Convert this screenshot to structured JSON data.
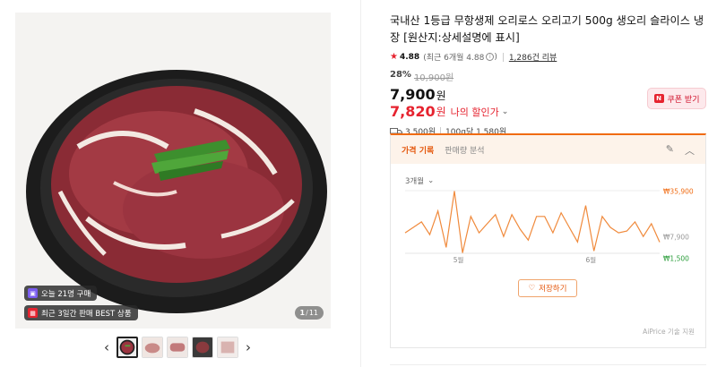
{
  "gallery": {
    "badge_buyers": "오늘 21명 구매",
    "badge_best": "최근 3일간 판매 BEST 상품",
    "counter_current": "1",
    "counter_total": "11",
    "thumb_count": 5
  },
  "product": {
    "title": "국내산 1등급 무항생제 오리로스 오리고기 500g 생오리 슬라이스 냉장 [원산지:상세설명에 표시]",
    "rating": "4.88",
    "rating_recent": "(최근 6개월 4.88",
    "rating_recent_close": ")",
    "review_count": "1,286건 리뷰",
    "discount_pct": "28%",
    "original_price": "10,900원",
    "price": "7,900",
    "price_unit": "원",
    "my_price": "7,820",
    "my_price_unit": "원",
    "my_price_label": "나의 할인가",
    "coupon_label": "쿠폰 받기",
    "coupon_icon_letter": "N",
    "shipping_fee": "3,500원",
    "unit_price": "100g당 1,580원"
  },
  "price_panel": {
    "tab_active": "가격 기록",
    "tab_other": "판매량 분석",
    "period": "3개월",
    "save_label": "저장하기",
    "ai_note": "AiPrice 기술 지원",
    "accent": "#f06b12"
  },
  "chart_data": {
    "type": "line",
    "x_labels": [
      "5월",
      "6월"
    ],
    "max_label": "₩35,900",
    "current_label": "₩7,900",
    "min_label": "₩1,500",
    "ylim": [
      0,
      40000
    ],
    "max_value": 35900,
    "current_value": 7900,
    "min_value": 1500,
    "values": [
      13000,
      16000,
      19000,
      12000,
      25000,
      5000,
      35900,
      2000,
      22000,
      13000,
      18000,
      23000,
      11000,
      23000,
      15000,
      9000,
      22000,
      22000,
      13000,
      24000,
      16000,
      8000,
      28000,
      3000,
      22000,
      16000,
      13000,
      14000,
      19000,
      11000,
      18000,
      7900
    ],
    "color": "#f08a3c"
  }
}
